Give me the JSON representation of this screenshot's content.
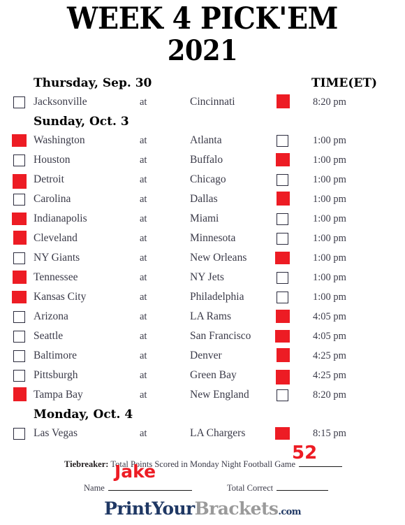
{
  "title": {
    "main": "WEEK 4 PICK'EM",
    "year": "2021"
  },
  "headers": {
    "time": "TIME(ET)"
  },
  "sections": [
    {
      "day": "Thursday, Sep. 30",
      "games": [
        {
          "away": "Jacksonville",
          "at": "at",
          "home": "Cincinnati",
          "time": "8:20 pm",
          "pick": "home"
        }
      ]
    },
    {
      "day": "Sunday, Oct. 3",
      "games": [
        {
          "away": "Washington",
          "at": "at",
          "home": "Atlanta",
          "time": "1:00 pm",
          "pick": "away"
        },
        {
          "away": "Houston",
          "at": "at",
          "home": "Buffalo",
          "time": "1:00 pm",
          "pick": "home"
        },
        {
          "away": "Detroit",
          "at": "at",
          "home": "Chicago",
          "time": "1:00 pm",
          "pick": "away"
        },
        {
          "away": "Carolina",
          "at": "at",
          "home": "Dallas",
          "time": "1:00 pm",
          "pick": "home"
        },
        {
          "away": "Indianapolis",
          "at": "at",
          "home": "Miami",
          "time": "1:00 pm",
          "pick": "away"
        },
        {
          "away": "Cleveland",
          "at": "at",
          "home": "Minnesota",
          "time": "1:00 pm",
          "pick": "away"
        },
        {
          "away": "NY Giants",
          "at": "at",
          "home": "New Orleans",
          "time": "1:00 pm",
          "pick": "home"
        },
        {
          "away": "Tennessee",
          "at": "at",
          "home": "NY Jets",
          "time": "1:00 pm",
          "pick": "away"
        },
        {
          "away": "Kansas City",
          "at": "at",
          "home": "Philadelphia",
          "time": "1:00 pm",
          "pick": "away"
        },
        {
          "away": "Arizona",
          "at": "at",
          "home": "LA Rams",
          "time": "4:05 pm",
          "pick": "home"
        },
        {
          "away": "Seattle",
          "at": "at",
          "home": "San Francisco",
          "time": "4:05 pm",
          "pick": "home"
        },
        {
          "away": "Baltimore",
          "at": "at",
          "home": "Denver",
          "time": "4:25 pm",
          "pick": "home"
        },
        {
          "away": "Pittsburgh",
          "at": "at",
          "home": "Green Bay",
          "time": "4:25 pm",
          "pick": "home"
        },
        {
          "away": "Tampa Bay",
          "at": "at",
          "home": "New England",
          "time": "8:20 pm",
          "pick": "away"
        }
      ]
    },
    {
      "day": "Monday, Oct. 4",
      "games": [
        {
          "away": "Las Vegas",
          "at": "at",
          "home": "LA Chargers",
          "time": "8:15 pm",
          "pick": "home"
        }
      ]
    }
  ],
  "footer": {
    "tiebreaker_label": "Tiebreaker:",
    "tiebreaker_text": "Total Points Scored in Monday Night Football Game",
    "tiebreaker_value": "52",
    "name_label": "Name",
    "name_value": "Jake",
    "total_correct_label": "Total Correct",
    "total_correct_value": ""
  },
  "logo": {
    "part1": "PrintYour",
    "part2": "Brackets",
    "part3": ".com"
  },
  "colors": {
    "mark_red": "#ED1C24",
    "logo_navy": "#1f3864",
    "logo_gray": "#9a9a9a"
  }
}
